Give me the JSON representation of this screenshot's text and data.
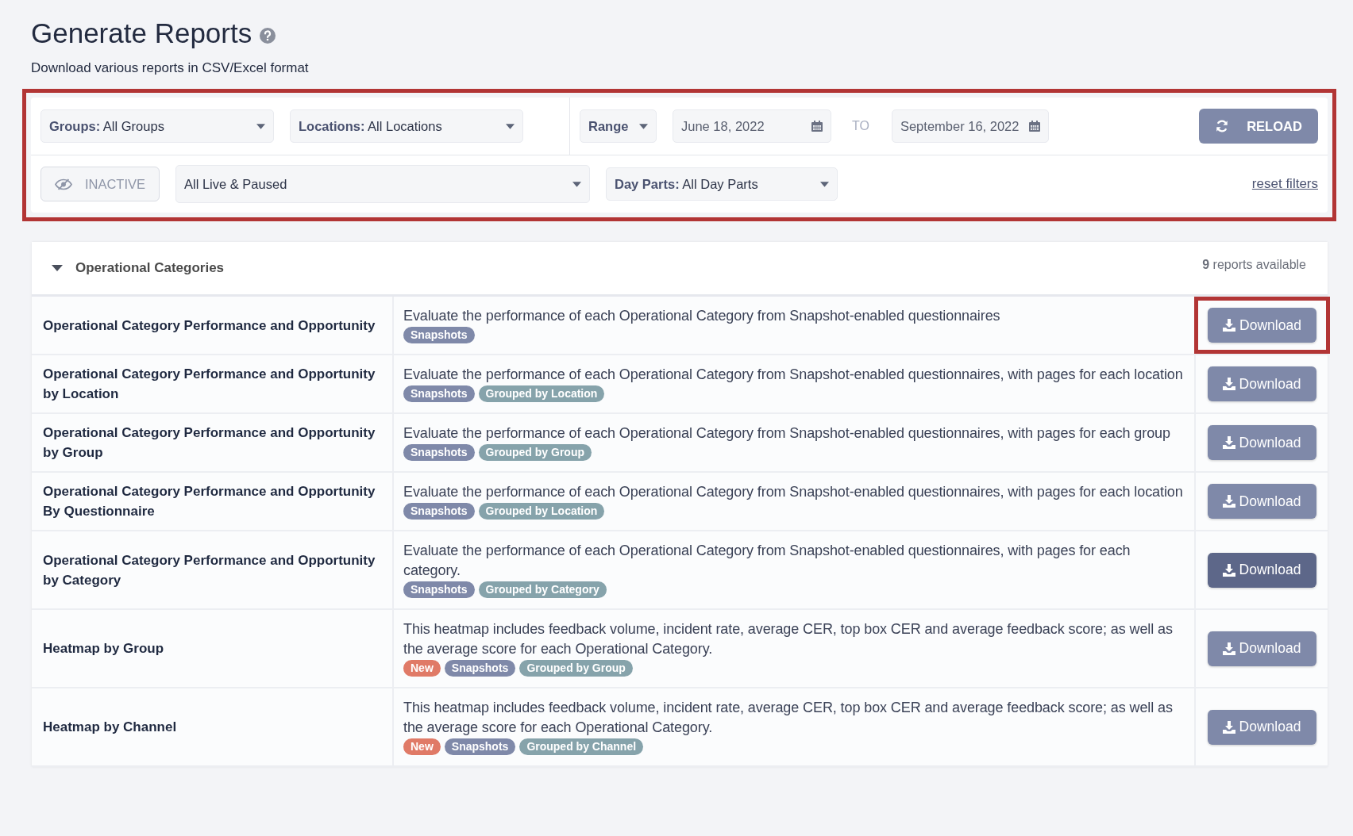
{
  "page": {
    "title": "Generate Reports",
    "subtitle": "Download various reports in CSV/Excel format"
  },
  "filters": {
    "highlighted": true,
    "groups": "**Groups:** All Groups",
    "locations": "**Locations:** All Locations",
    "range": "Range",
    "start_date": "June 18, 2022",
    "separator": "TO",
    "end_date": "September 16, 2022",
    "reload_button": "RELOAD",
    "inactive_button": {
      "label": "INACTIVE",
      "disabled": true
    },
    "status": "All Live & Paused",
    "day_parts": "**Day Parts:** All Day Parts",
    "reset_link": "reset filters"
  },
  "section": {
    "title": "Operational Categories",
    "expanded": true,
    "count": "**9** reports available"
  },
  "reports": [
    {
      "name": "Operational Category Performance and Opportunity",
      "description": "Evaluate the performance of each Operational Category from Snapshot-enabled questionnaires",
      "tags": [
        {
          "label": "Snapshots",
          "kind": "feature"
        }
      ],
      "button": {
        "label": "Download",
        "highlighted": true,
        "hovered": false
      }
    },
    {
      "name": "Operational Category Performance and Opportunity by Location",
      "description": "Evaluate the performance of each Operational Category from Snapshot-enabled questionnaires, with pages for each location",
      "tags": [
        {
          "label": "Snapshots",
          "kind": "feature"
        },
        {
          "label": "Grouped by Location",
          "kind": "grouping"
        }
      ],
      "button": {
        "label": "Download",
        "highlighted": false,
        "hovered": false
      }
    },
    {
      "name": "Operational Category Performance and Opportunity by Group",
      "description": "Evaluate the performance of each Operational Category from Snapshot-enabled questionnaires, with pages for each group",
      "tags": [
        {
          "label": "Snapshots",
          "kind": "feature"
        },
        {
          "label": "Grouped by Group",
          "kind": "grouping"
        }
      ],
      "button": {
        "label": "Download",
        "highlighted": false,
        "hovered": false
      }
    },
    {
      "name": "Operational Category Performance and Opportunity By Questionnaire",
      "description": "Evaluate the performance of each Operational Category from Snapshot-enabled questionnaires, with pages for each location",
      "tags": [
        {
          "label": "Snapshots",
          "kind": "feature"
        },
        {
          "label": "Grouped by Location",
          "kind": "grouping"
        }
      ],
      "button": {
        "label": "Download",
        "highlighted": false,
        "hovered": false
      }
    },
    {
      "name": "Operational Category Performance and Opportunity by Category",
      "description": "Evaluate the performance of each Operational Category from Snapshot-enabled questionnaires, with pages for each category.",
      "tags": [
        {
          "label": "Snapshots",
          "kind": "feature"
        },
        {
          "label": "Grouped by Category",
          "kind": "grouping"
        }
      ],
      "button": {
        "label": "Download",
        "highlighted": false,
        "hovered": true
      }
    },
    {
      "name": "Heatmap by Group",
      "description": "This heatmap includes feedback volume, incident rate, average CER, top box CER and average feedback score; as well as the average score for each Operational Category.",
      "tags": [
        {
          "label": "New",
          "kind": "new"
        },
        {
          "label": "Snapshots",
          "kind": "feature"
        },
        {
          "label": "Grouped by Group",
          "kind": "grouping"
        }
      ],
      "button": {
        "label": "Download",
        "highlighted": false,
        "hovered": false
      }
    },
    {
      "name": "Heatmap by Channel",
      "description": "This heatmap includes feedback volume, incident rate, average CER, top box CER and average feedback score; as well as the average score for each Operational Category.",
      "tags": [
        {
          "label": "New",
          "kind": "new"
        },
        {
          "label": "Snapshots",
          "kind": "feature"
        },
        {
          "label": "Grouped by Channel",
          "kind": "grouping"
        }
      ],
      "button": {
        "label": "Download",
        "highlighted": false,
        "hovered": false
      }
    }
  ]
}
